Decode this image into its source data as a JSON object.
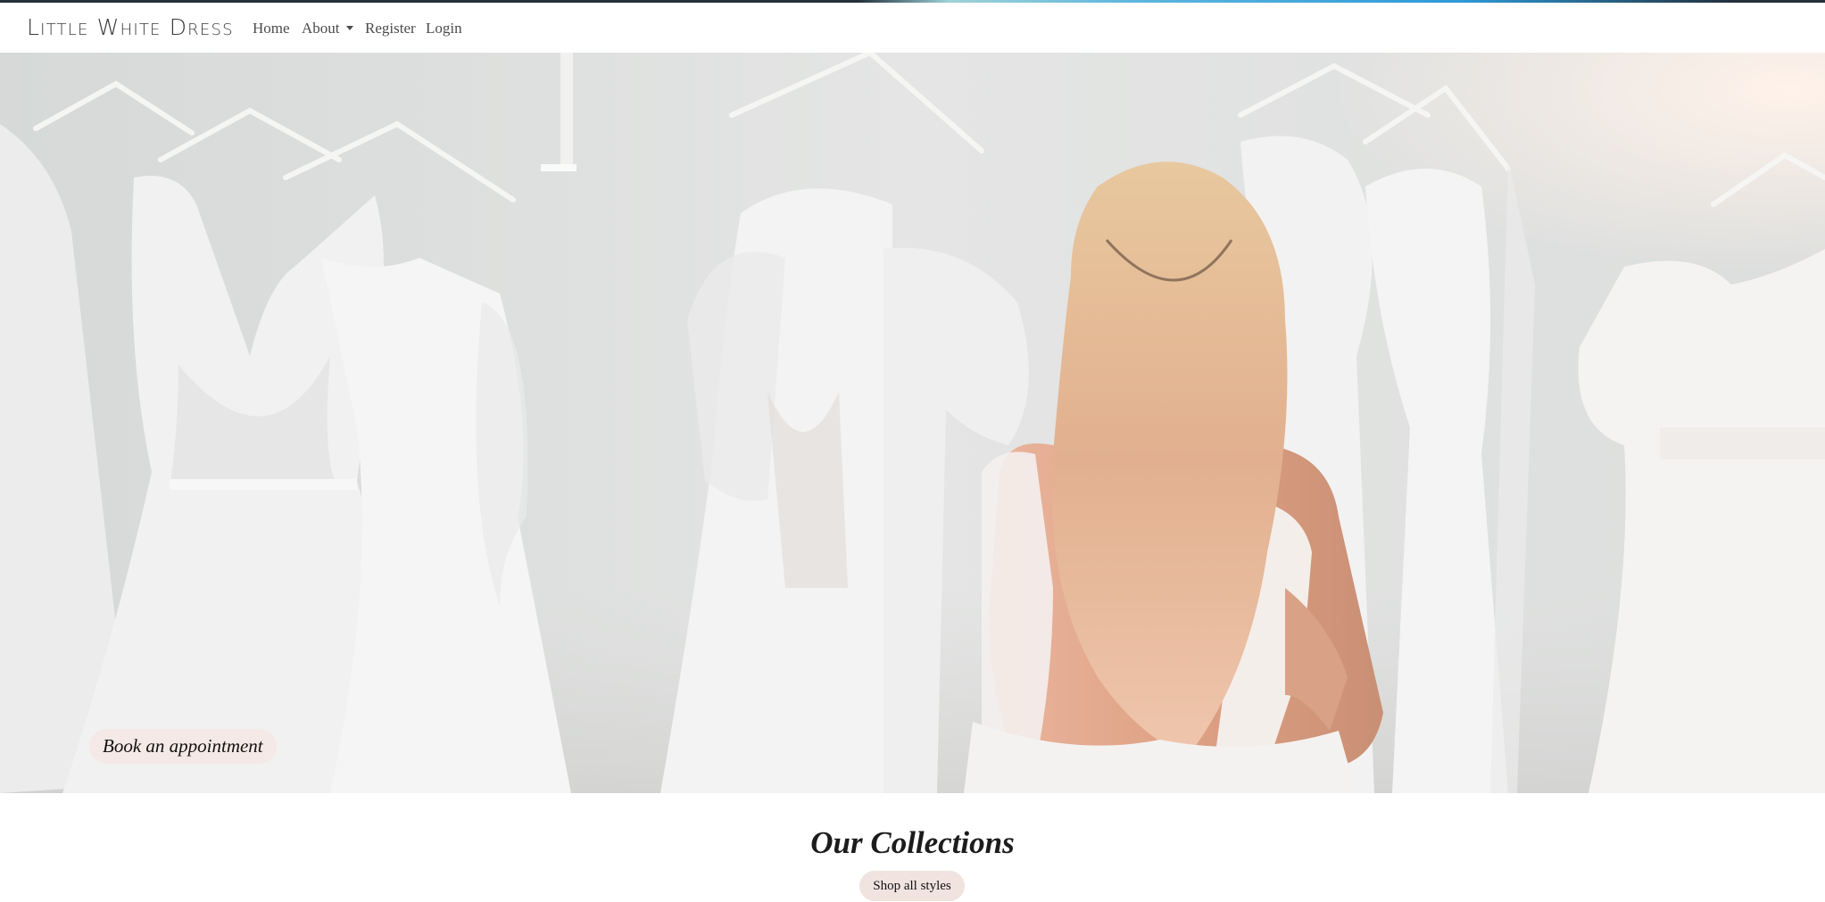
{
  "navbar": {
    "brand": "Little White Dress",
    "links": {
      "home": "Home",
      "about": "About",
      "register": "Register",
      "login": "Login"
    }
  },
  "hero": {
    "image_description_icon": "bridal-boutique-photo",
    "cta_label": "Book an appointment"
  },
  "collections": {
    "title": "Our Collections",
    "cta_label": "Shop all styles"
  },
  "colors": {
    "button_bg": "#f4e9e6",
    "text": "#212529",
    "nav_text": "#4b4b4b"
  }
}
